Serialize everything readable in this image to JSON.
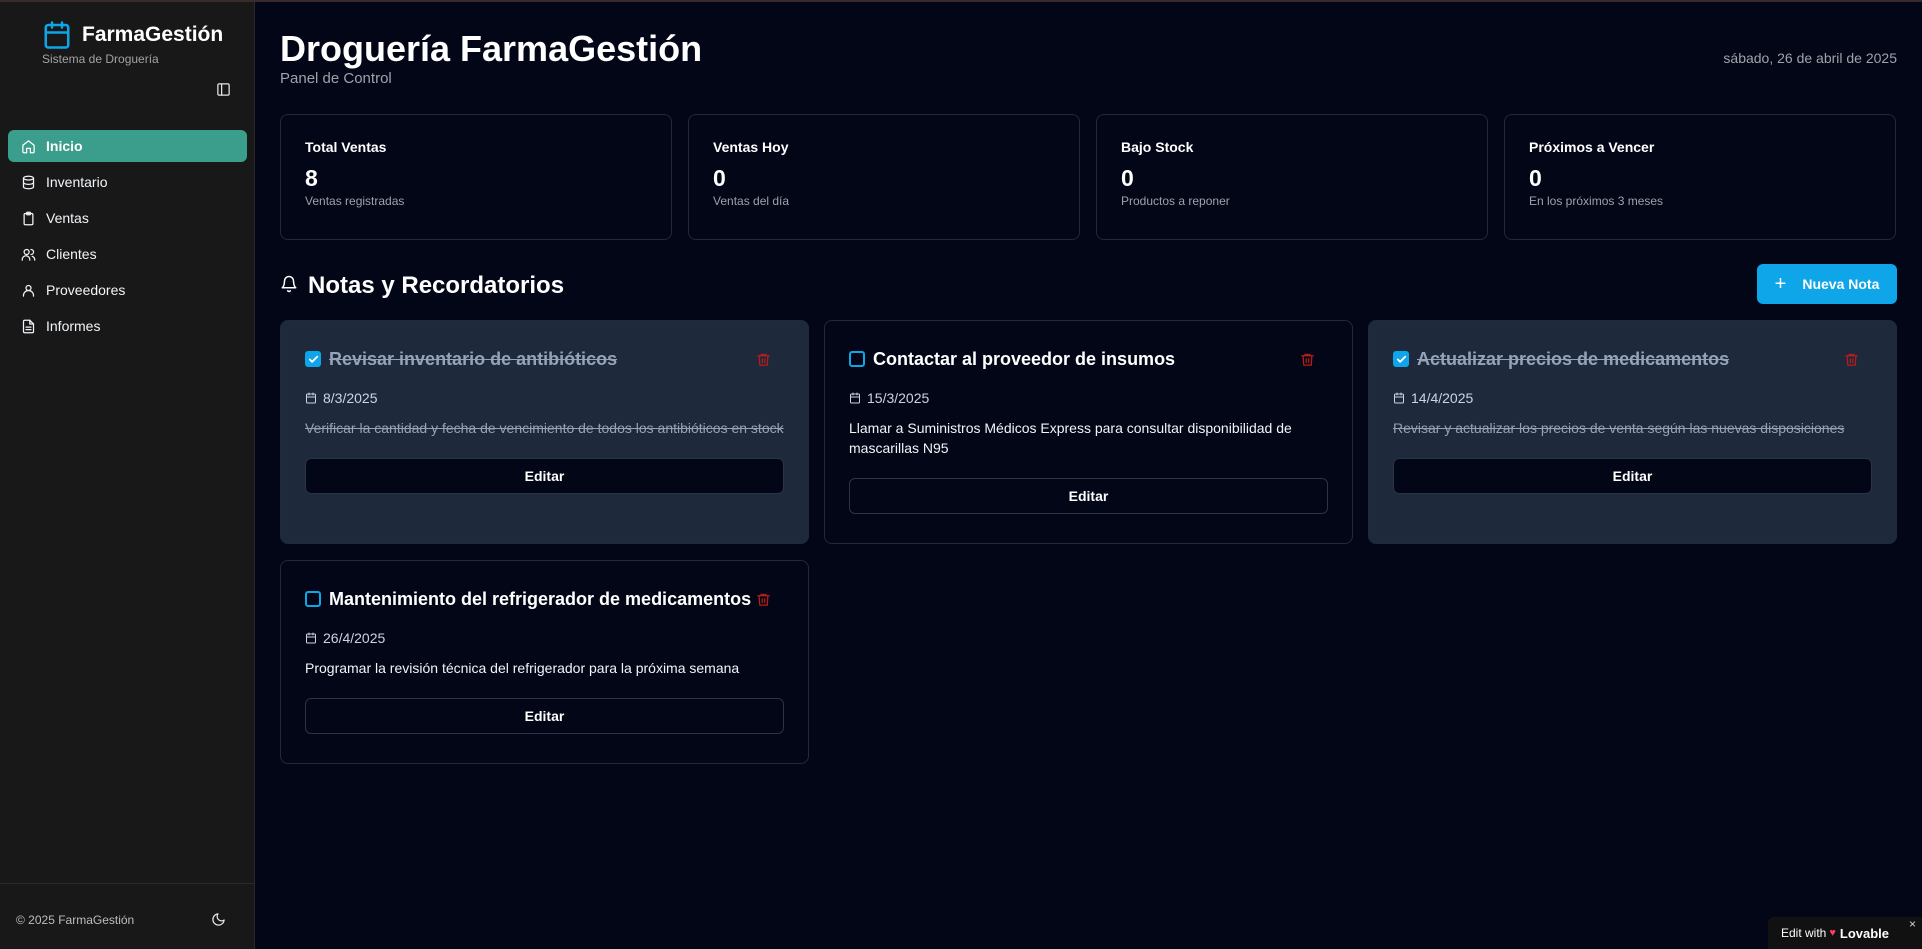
{
  "sidebar": {
    "brand_name": "FarmaGestión",
    "brand_sub": "Sistema de Droguería",
    "items": [
      {
        "label": "Inicio",
        "icon": "home-icon",
        "active": true
      },
      {
        "label": "Inventario",
        "icon": "database-icon",
        "active": false
      },
      {
        "label": "Ventas",
        "icon": "clipboard-icon",
        "active": false
      },
      {
        "label": "Clientes",
        "icon": "users-icon",
        "active": false
      },
      {
        "label": "Proveedores",
        "icon": "user-icon",
        "active": false
      },
      {
        "label": "Informes",
        "icon": "file-text-icon",
        "active": false
      }
    ],
    "copyright": "© 2025 FarmaGestión"
  },
  "header": {
    "title": "Droguería FarmaGestión",
    "subtitle": "Panel de Control",
    "date": "sábado, 26 de abril de 2025"
  },
  "stats": [
    {
      "title": "Total Ventas",
      "value": "8",
      "desc": "Ventas registradas"
    },
    {
      "title": "Ventas Hoy",
      "value": "0",
      "desc": "Ventas del día"
    },
    {
      "title": "Bajo Stock",
      "value": "0",
      "desc": "Productos a reponer"
    },
    {
      "title": "Próximos a Vencer",
      "value": "0",
      "desc": "En los próximos 3 meses"
    }
  ],
  "notes": {
    "title": "Notas y Recordatorios",
    "new_label": "Nueva Nota",
    "edit_label": "Editar",
    "items": [
      {
        "title": "Revisar inventario de antibióticos",
        "date": "8/3/2025",
        "body": "Verificar la cantidad y fecha de vencimiento de todos los antibióticos en stock",
        "completed": true
      },
      {
        "title": "Contactar al proveedor de insumos",
        "date": "15/3/2025",
        "body": "Llamar a Suministros Médicos Express para consultar disponibilidad de mascarillas N95",
        "completed": false
      },
      {
        "title": "Actualizar precios de medicamentos",
        "date": "14/4/2025",
        "body": "Revisar y actualizar los precios de venta según las nuevas disposiciones",
        "completed": true
      },
      {
        "title": "Mantenimiento del refrigerador de medicamentos",
        "date": "26/4/2025",
        "body": "Programar la revisión técnica del refrigerador para la próxima semana",
        "completed": false
      }
    ]
  },
  "badge": {
    "prefix": "Edit with",
    "brand": "Lovable",
    "close": "×"
  },
  "colors": {
    "accent": "#0ea5e9",
    "active_nav": "#3b9d8c",
    "danger": "#b91c1c",
    "background": "#020617"
  }
}
